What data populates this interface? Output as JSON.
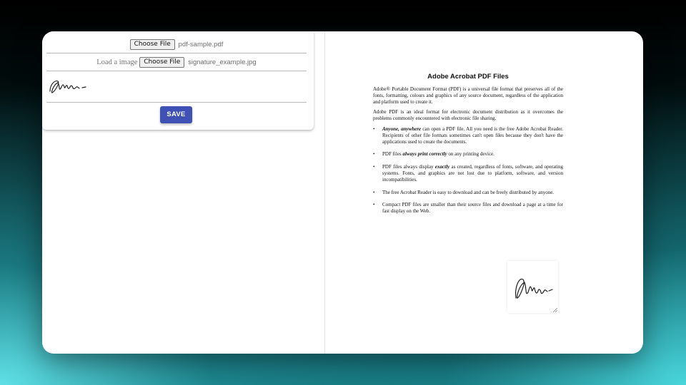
{
  "form": {
    "pdf_input": {
      "button_label": "Choose File",
      "file_name": "pdf-sample.pdf"
    },
    "image_input": {
      "label": "Load a image",
      "button_label": "Choose File",
      "file_name": "signature_example.jpg"
    },
    "save_label": "SAVE",
    "signature_icon": "handwritten-signature"
  },
  "document": {
    "title": "Adobe Acrobat PDF Files",
    "paragraphs": [
      "Adobe® Portable Document Format (PDF) is a universal file format that preserves all of the fonts, formatting, colours and graphics of any source document, regardless of the application and platform used to create it.",
      "Adobe PDF is an ideal format for electronic document distribution as it overcomes the problems commonly encountered with electronic file sharing."
    ],
    "bullets": [
      {
        "emphasis": "Anyone, anywhere",
        "text": " can open a PDF file. All you need is the free Adobe Acrobat Reader. Recipients of other file formats sometimes can't open files because they don't have the applications used to create the documents."
      },
      {
        "pre": "PDF files ",
        "emphasis": "always print correctly",
        "text": " on any printing device."
      },
      {
        "pre": "PDF files always display ",
        "emphasis": "exactly",
        "text": " as created, regardless of fonts, software, and operating systems. Fonts, and graphics are not lost due to platform, software, and version incompatibilities."
      },
      {
        "text": "The free Acrobat Reader is easy to download and can be freely distributed by anyone."
      },
      {
        "text": "Compact PDF files are smaller than their source files and download a page at a time for fast display on the Web."
      }
    ],
    "bullet_char": "•"
  },
  "colors": {
    "save_button": "#3f51b5",
    "background_accent": "#49d6dc"
  }
}
